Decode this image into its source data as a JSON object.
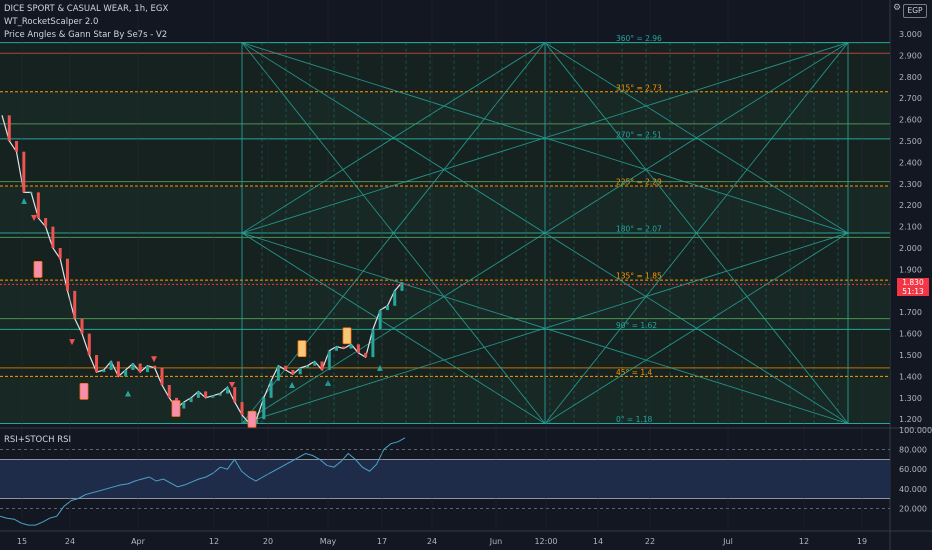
{
  "header": {
    "symbol_line": "DICE SPORT & CASUAL WEAR, 1h, EGX",
    "indicator_1": "WT_RocketScalper 2.0",
    "indicator_2": "Price Angles & Gann Star By Se7s - V2"
  },
  "price_axis": {
    "currency": "EGP",
    "ticks": [
      "3.000",
      "2.900",
      "2.800",
      "2.700",
      "2.600",
      "2.500",
      "2.400",
      "2.300",
      "2.200",
      "2.100",
      "2.000",
      "1.900",
      "1.800",
      "1.700",
      "1.600",
      "1.500",
      "1.400",
      "1.300",
      "1.200"
    ],
    "last_price": "1.830",
    "countdown": "51:13"
  },
  "gann_levels": [
    {
      "label": "360° = 2.96",
      "value": 2.96,
      "color": "#26a69a"
    },
    {
      "label": "315° = 2.73",
      "value": 2.73,
      "color": "#ff9800"
    },
    {
      "label": "270° = 2.51",
      "value": 2.51,
      "color": "#26a69a"
    },
    {
      "label": "225° = 2.29",
      "value": 2.29,
      "color": "#ff9800"
    },
    {
      "label": "180° = 2.07",
      "value": 2.07,
      "color": "#26a69a"
    },
    {
      "label": "135° = 1.85",
      "value": 1.85,
      "color": "#ff9800"
    },
    {
      "label": "90° = 1.62",
      "value": 1.62,
      "color": "#26a69a"
    },
    {
      "label": "45° = 1.4",
      "value": 1.4,
      "color": "#ff9800"
    },
    {
      "label": "0° = 1.18",
      "value": 1.18,
      "color": "#26a69a"
    }
  ],
  "rsi_panel": {
    "title": "RSI+STOCH RSI",
    "ticks": [
      "100.000",
      "80.000",
      "60.000",
      "40.000",
      "20.000"
    ]
  },
  "time_axis": {
    "labels": [
      "15",
      "24",
      "Apr",
      "12",
      "20",
      "May",
      "17",
      "24",
      "Jun",
      "12:00",
      "14",
      "22",
      "Jul",
      "12",
      "19"
    ]
  },
  "chart_data": {
    "type": "line",
    "series": [
      {
        "values": [
          2.62,
          2.5,
          2.45,
          2.26,
          2.26,
          2.14,
          2.1,
          2.0,
          1.95,
          1.8,
          1.67,
          1.6,
          1.5,
          1.42,
          1.43,
          1.47,
          1.4,
          1.43,
          1.46,
          1.42,
          1.45,
          1.44,
          1.36,
          1.3,
          1.25,
          1.28,
          1.3,
          1.33,
          1.3,
          1.31,
          1.32,
          1.35,
          1.28,
          1.22,
          1.18,
          1.2,
          1.3,
          1.38,
          1.45,
          1.43,
          1.41,
          1.44,
          1.45,
          1.47,
          1.43,
          1.52,
          1.54,
          1.53,
          1.55,
          1.51,
          1.49,
          1.62,
          1.71,
          1.73,
          1.8,
          1.84
        ]
      }
    ],
    "rsi": [
      12,
      10,
      9,
      5,
      3,
      3,
      6,
      10,
      12,
      22,
      28,
      30,
      34,
      36,
      38,
      40,
      42,
      44,
      45,
      48,
      50,
      52,
      48,
      50,
      46,
      42,
      44,
      47,
      50,
      52,
      56,
      62,
      60,
      70,
      58,
      52,
      48,
      52,
      56,
      60,
      64,
      68,
      72,
      76,
      74,
      70,
      64,
      62,
      68,
      76,
      70,
      62,
      58,
      65,
      80,
      86,
      88,
      92
    ],
    "ylim": [
      1.18,
      3.0
    ]
  }
}
